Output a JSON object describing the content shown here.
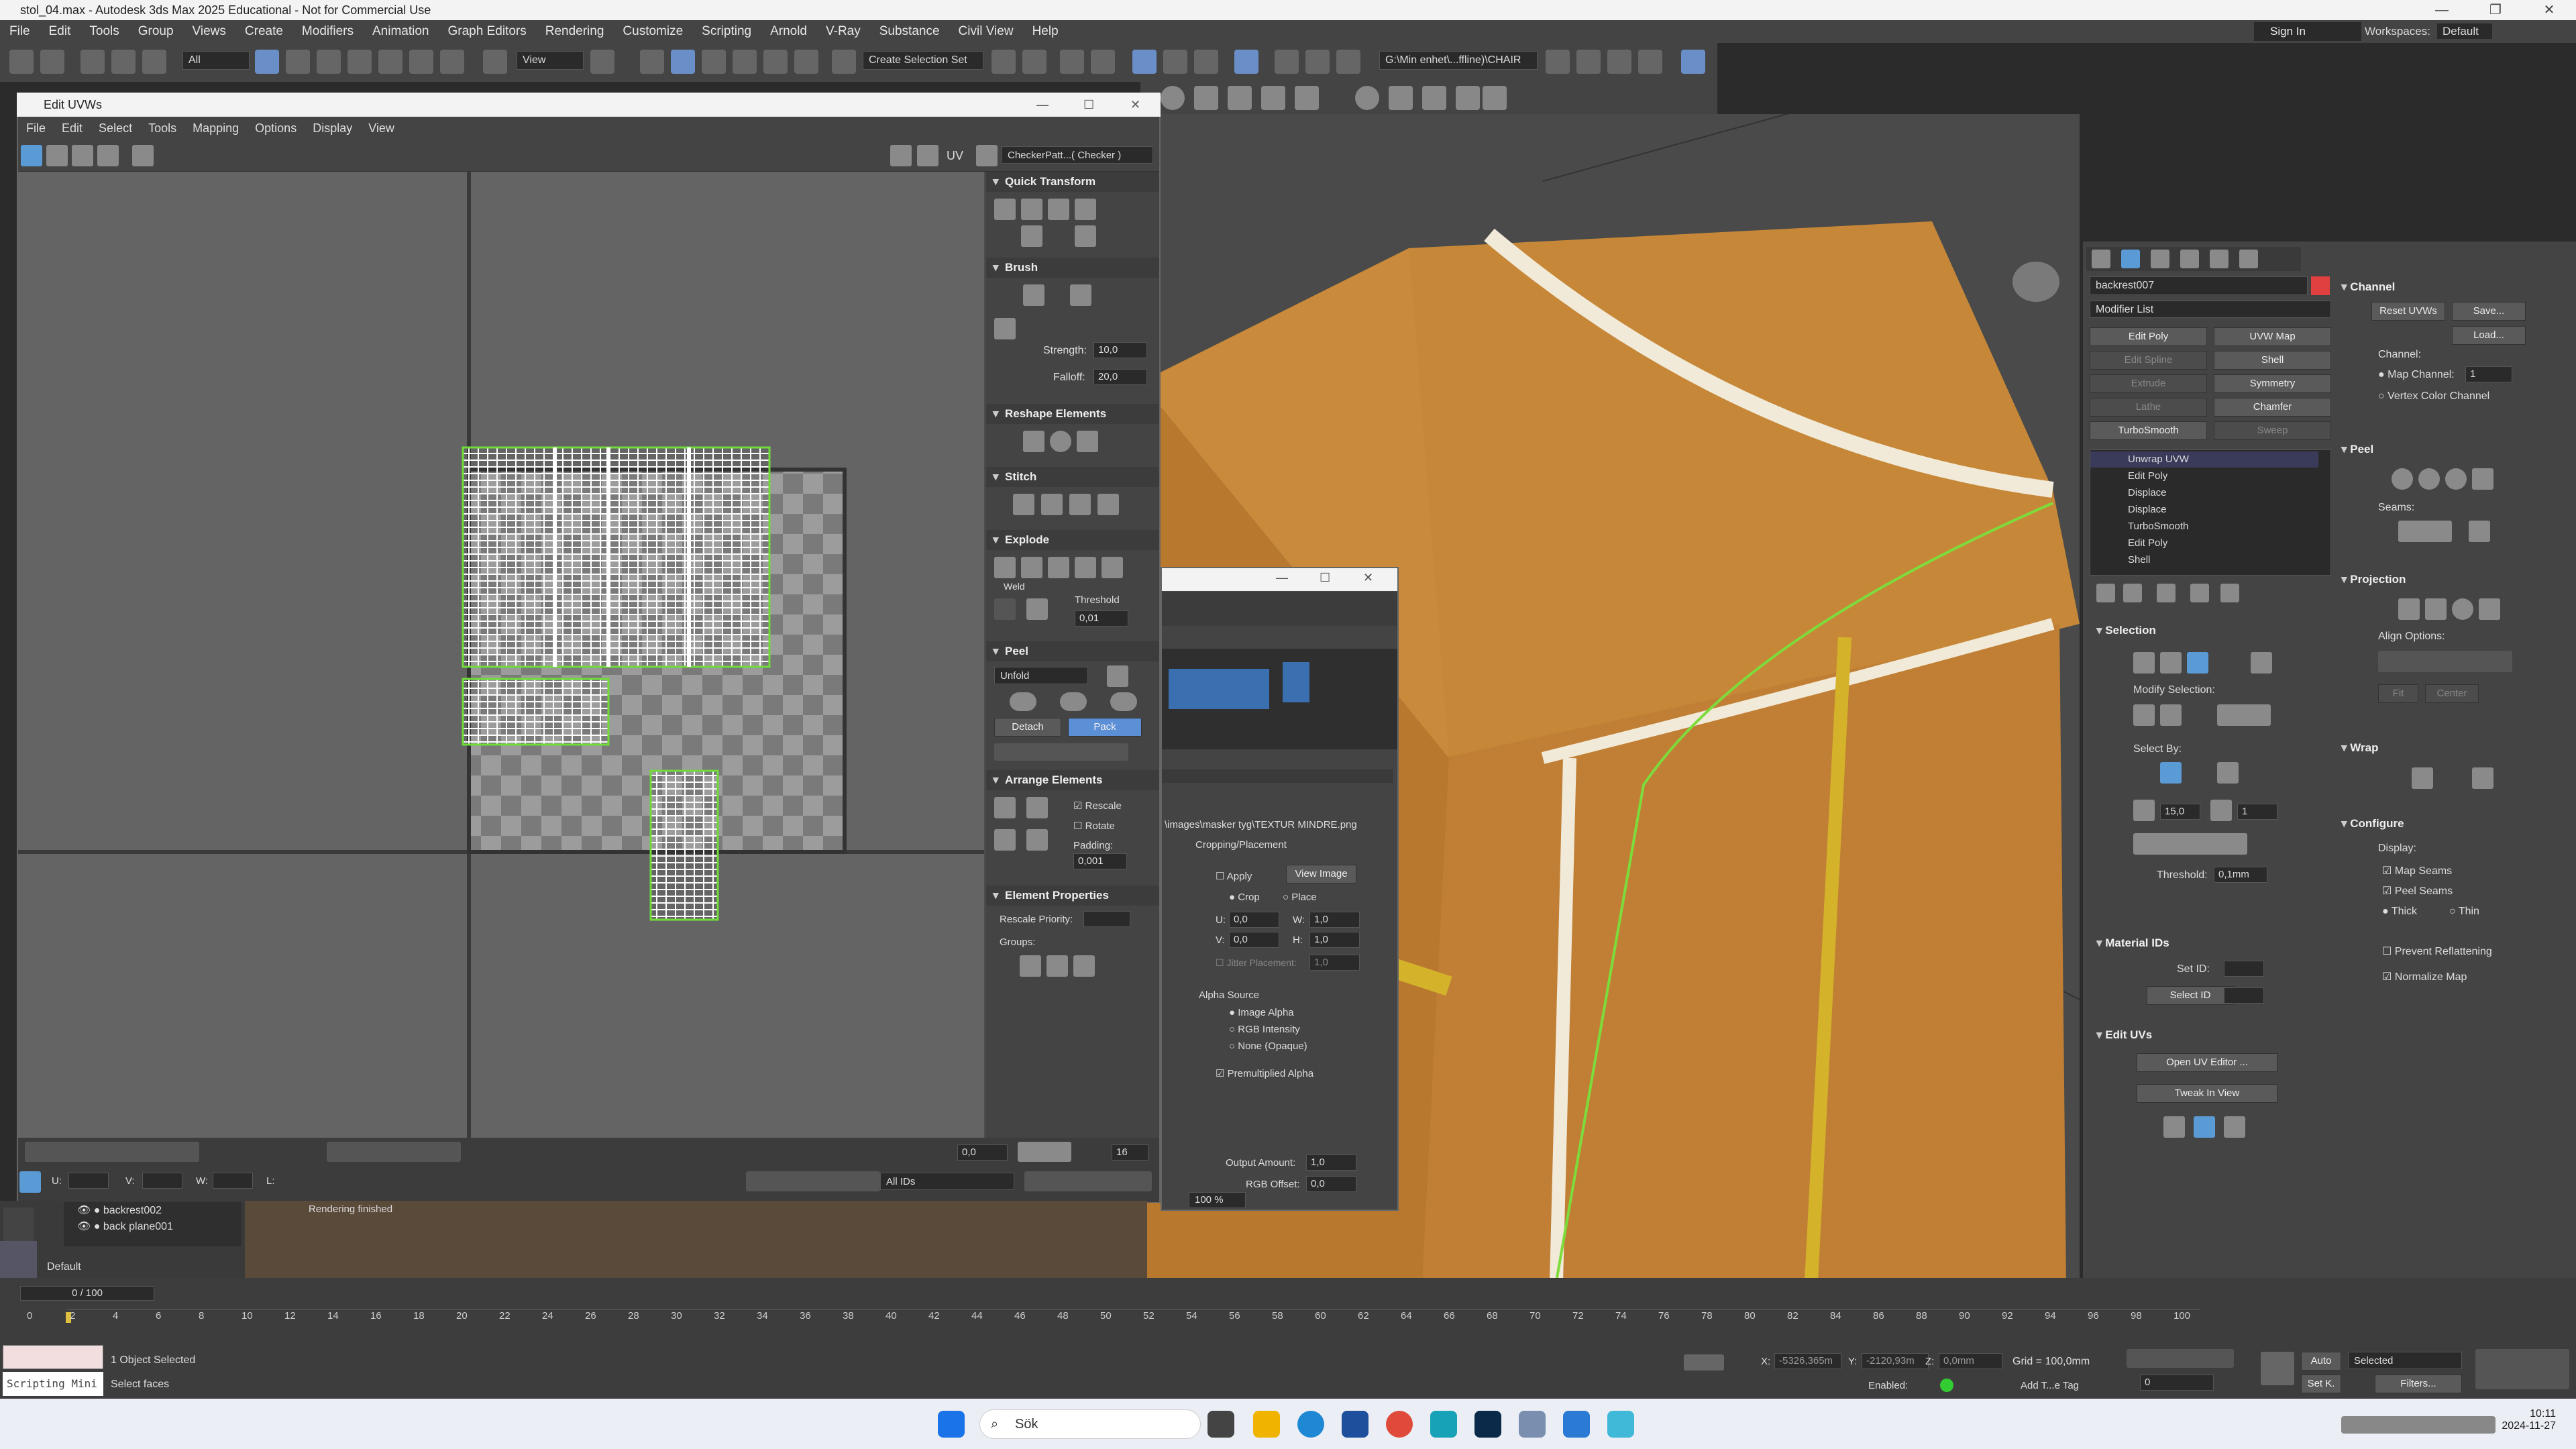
{
  "app": {
    "title": "stol_04.max - Autodesk 3ds Max 2025 Educational - Not for Commercial Use"
  },
  "menu": [
    "File",
    "Edit",
    "Tools",
    "Group",
    "Views",
    "Create",
    "Modifiers",
    "Animation",
    "Graph Editors",
    "Rendering",
    "Customize",
    "Scripting",
    "Arnold",
    "V-Ray",
    "Substance",
    "Civil View",
    "Help"
  ],
  "signin": "Sign In",
  "workspaces_label": "Workspaces:",
  "workspace": "Default",
  "toolbar": {
    "filter": "All",
    "view": "View",
    "selection_set": "Create Selection Set",
    "path": "G:\\Min enhet\\...ffline)\\CHAIR"
  },
  "uvw": {
    "title": "Edit UVWs",
    "menu": [
      "File",
      "Edit",
      "Select",
      "Tools",
      "Mapping",
      "Options",
      "Display",
      "View"
    ],
    "uv_label": "UV",
    "checker": "CheckerPatt...( Checker )",
    "quick_transform": "Quick Transform",
    "brush": "Brush",
    "strength_label": "Strength:",
    "strength": "10,0",
    "falloff_label": "Falloff:",
    "falloff": "20,0",
    "reshape": "Reshape Elements",
    "stitch": "Stitch",
    "explode": "Explode",
    "weld": "Weld",
    "threshold_label": "Threshold",
    "threshold": "0,01",
    "peel": "Peel",
    "unfold": "Unfold",
    "detach": "Detach",
    "pack": "Pack",
    "arrange": "Arrange Elements",
    "rescale": "Rescale",
    "rotate": "Rotate",
    "padding_label": "Padding:",
    "padding": "0,001",
    "elem_props": "Element Properties",
    "rescale_priority": "Rescale Priority:",
    "groups": "Groups:",
    "bottom": {
      "u_label": "U:",
      "v_label": "V:",
      "w_label": "W:",
      "l_label": "L:",
      "val": "0,0",
      "grid": "16",
      "ids": "All IDs"
    }
  },
  "material": {
    "path": "\\images\\masker tyg\\TEXTUR MINDRE.png",
    "cropping": "Cropping/Placement",
    "apply": "Apply",
    "view_image": "View Image",
    "crop": "Crop",
    "place": "Place",
    "u_label": "U:",
    "u": "0,0",
    "w_label": "W:",
    "w": "1,0",
    "v_label": "V:",
    "v": "0,0",
    "h_label": "H:",
    "h": "1,0",
    "jitter": "Jitter Placement:",
    "jitter_val": "1,0",
    "alpha_source": "Alpha Source",
    "image_alpha": "Image Alpha",
    "rgb_intensity": "RGB Intensity",
    "none_opaque": "None (Opaque)",
    "premult": "Premultiplied Alpha",
    "output_amount_label": "Output Amount:",
    "output_amount": "1,0",
    "rgb_offset_label": "RGB Offset:",
    "rgb_offset": "0,0",
    "zoom": "100 %"
  },
  "command": {
    "object": "backrest007",
    "modifier_list": "Modifier List",
    "buttons": [
      "Edit Poly",
      "UVW Map",
      "Edit Spline",
      "Shell",
      "Extrude",
      "Symmetry",
      "Lathe",
      "Chamfer",
      "TurboSmooth",
      "Sweep"
    ],
    "stack": [
      "Unwrap UVW",
      "Edit Poly",
      "Displace",
      "Displace",
      "TurboSmooth",
      "Edit Poly",
      "Shell"
    ],
    "selection": "Selection",
    "modify_selection": "Modify Selection:",
    "select_by": "Select By:",
    "sel_angle": "15,0",
    "sel_count": "1",
    "threshold_label": "Threshold:",
    "threshold": "0,1mm",
    "material_ids": "Material IDs",
    "set_id": "Set ID:",
    "select_id": "Select ID",
    "edit_uvs": "Edit UVs",
    "open_uv_editor": "Open UV Editor ...",
    "tweak": "Tweak In View",
    "channel": "Channel",
    "reset_uvws": "Reset UVWs",
    "save": "Save...",
    "load": "Load...",
    "channel_label": "Channel:",
    "map_channel": "Map Channel:",
    "map_channel_val": "1",
    "vertex_color": "Vertex Color Channel",
    "peel": "Peel",
    "seams": "Seams:",
    "projection": "Projection",
    "align_options": "Align Options:",
    "fit": "Fit",
    "center": "Center",
    "wrap": "Wrap",
    "configure": "Configure",
    "display": "Display:",
    "map_seams": "Map Seams",
    "peel_seams": "Peel Seams",
    "thick": "Thick",
    "thin": "Thin",
    "prevent_reflat": "Prevent Reflattening",
    "normalize": "Normalize Map"
  },
  "layers": [
    "backrest002",
    "back plane001"
  ],
  "layer_default": "Default",
  "render_msg": "Rendering finished",
  "timeline": {
    "frame": "0 / 100",
    "ticks": [
      "0",
      "2",
      "4",
      "6",
      "8",
      "10",
      "12",
      "14",
      "16",
      "18",
      "20",
      "22",
      "24",
      "26",
      "28",
      "30",
      "32",
      "34",
      "36",
      "38",
      "40",
      "42",
      "44",
      "46",
      "48",
      "50",
      "52",
      "54",
      "56",
      "58",
      "60",
      "62",
      "64",
      "66",
      "68",
      "70",
      "72",
      "74",
      "76",
      "78",
      "80",
      "82",
      "84",
      "86",
      "88",
      "90",
      "92",
      "94",
      "96",
      "98",
      "100"
    ]
  },
  "status": {
    "selected": "1 Object Selected",
    "select_faces": "Select faces",
    "x_label": "X:",
    "x": "-5326,365m",
    "y_label": "Y:",
    "y": "-2120,93m",
    "z_label": "Z:",
    "z": "0,0mm",
    "grid": "Grid = 100,0mm",
    "enabled": "Enabled:",
    "add_tag": "Add T...e Tag",
    "auto": "Auto",
    "set_k": "Set K.",
    "selected_mode": "Selected",
    "filters": "Filters...",
    "frame_field": "0",
    "script": "Scripting Mini"
  },
  "taskbar": {
    "search": "Sök",
    "time": "10:11",
    "date": "2024-11-27"
  }
}
